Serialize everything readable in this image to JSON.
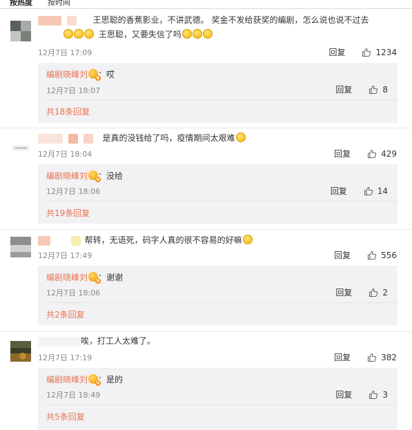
{
  "tabs": {
    "hot": "按热度",
    "time": "按时间"
  },
  "comments": [
    {
      "line1": "王思聪的香蕉影业，不讲武德。 奖金不发给获奖的编剧，怎么说也说不过去",
      "line2": "王思聪，又要失信了吗",
      "time": "12月7日 17:09",
      "reply_label": "回复",
      "likes": "1234",
      "reply": {
        "author": "编剧晓峰刘",
        "text": "：哎",
        "time": "12月7日 18:07",
        "reply_label": "回复",
        "likes": "8",
        "more": "共18条回复"
      }
    },
    {
      "line1": "是真的没钱给了吗，疫情期间太艰难",
      "time": "12月7日 18:04",
      "reply_label": "回复",
      "likes": "429",
      "reply": {
        "author": "编剧晓峰刘",
        "text": "：没给",
        "time": "12月7日 18:06",
        "reply_label": "回复",
        "likes": "14",
        "more": "共19条回复"
      }
    },
    {
      "line1": "帮转，无语死，码字人真的很不容易的好嘛",
      "time": "12月7日 17:49",
      "reply_label": "回复",
      "likes": "556",
      "reply": {
        "author": "编剧晓峰刘",
        "text": "：谢谢",
        "time": "12月7日 18:06",
        "reply_label": "回复",
        "likes": "2",
        "more": "共2条回复"
      }
    },
    {
      "line1": "唉，打工人太难了。",
      "time": "12月7日 17:19",
      "reply_label": "回复",
      "likes": "382",
      "reply": {
        "author": "编剧晓峰刘",
        "text": "：是的",
        "time": "12月7日 18:49",
        "reply_label": "回复",
        "likes": "3",
        "more": "共5条回复"
      }
    }
  ],
  "colors": {
    "accent": "#eb7350",
    "reply_bg": "#f2f2f5",
    "meta": "#888888"
  }
}
